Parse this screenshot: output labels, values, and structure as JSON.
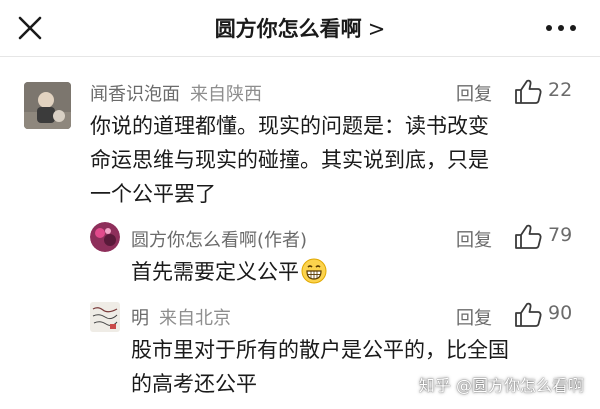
{
  "header": {
    "title": "圆方你怎么看啊",
    "chevron": ">",
    "close_icon": "close-icon",
    "more_icon": "more-horizontal-icon"
  },
  "comments": [
    {
      "author": "闻香识泡面",
      "location": "来自陕西",
      "reply_label": "回复",
      "likes": "22",
      "lines": [
        "你说的道理都懂。现实的问题是：读书改变",
        "命运思维与现实的碰撞。其实说到底，只是",
        "一个公平罢了"
      ]
    },
    {
      "author": "圆方你怎么看啊(作者)",
      "reply_label": "回复",
      "likes": "79",
      "lines": [
        "首先需要定义公平"
      ],
      "emoji": "grinning-face-emoji"
    },
    {
      "author": "明",
      "location": "来自北京",
      "reply_label": "回复",
      "likes": "90",
      "lines": [
        "股市里对于所有的散户是公平的，比全国",
        "的高考还公平"
      ]
    }
  ],
  "watermark": "知乎 @圆方你怎么看啊",
  "colors": {
    "accent": "#1f1f1f",
    "muted": "#6b6b6b"
  }
}
